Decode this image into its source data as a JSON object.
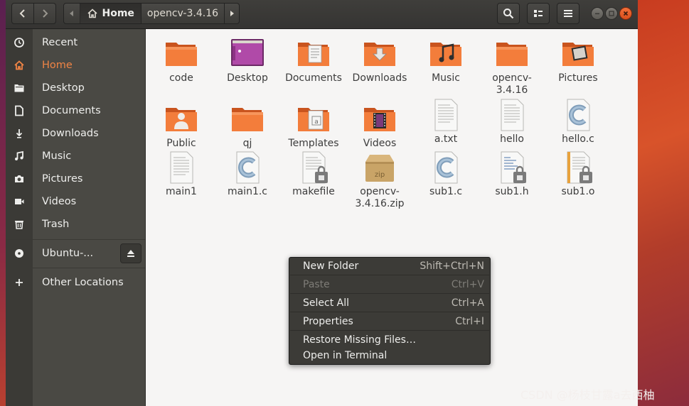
{
  "header": {
    "back_icon": "chevron-left-icon",
    "forward_icon": "chevron-right-icon",
    "path": [
      {
        "label": "Home",
        "icon": "home-icon"
      },
      {
        "label": "opencv-3.4.16"
      }
    ],
    "actions": [
      "search-icon",
      "view-toggle-icon",
      "menu-icon"
    ],
    "window_controls": [
      "minimize-icon",
      "maximize-icon",
      "close-icon"
    ]
  },
  "sidebar": {
    "items": [
      {
        "label": "Recent",
        "icon": "clock-icon"
      },
      {
        "label": "Home",
        "icon": "home-icon",
        "active": true
      },
      {
        "label": "Desktop",
        "icon": "folder-icon"
      },
      {
        "label": "Documents",
        "icon": "document-icon"
      },
      {
        "label": "Downloads",
        "icon": "download-icon"
      },
      {
        "label": "Music",
        "icon": "music-icon"
      },
      {
        "label": "Pictures",
        "icon": "camera-icon"
      },
      {
        "label": "Videos",
        "icon": "video-icon"
      },
      {
        "label": "Trash",
        "icon": "trash-icon"
      }
    ],
    "device": {
      "label": "Ubuntu-...",
      "icon": "disc-icon",
      "eject_icon": "eject-icon"
    },
    "other": {
      "label": "Other Locations",
      "icon": "plus-icon"
    }
  },
  "files": [
    {
      "name": "code",
      "type": "folder"
    },
    {
      "name": "Desktop",
      "type": "folder-desktop"
    },
    {
      "name": "Documents",
      "type": "folder-documents"
    },
    {
      "name": "Downloads",
      "type": "folder-downloads"
    },
    {
      "name": "Music",
      "type": "folder-music"
    },
    {
      "name": "opencv-\n3.4.16",
      "type": "folder"
    },
    {
      "name": "Pictures",
      "type": "folder-pictures"
    },
    {
      "name": "Public",
      "type": "folder-public"
    },
    {
      "name": "qj",
      "type": "folder"
    },
    {
      "name": "Templates",
      "type": "folder-templates"
    },
    {
      "name": "Videos",
      "type": "folder-videos"
    },
    {
      "name": "a.txt",
      "type": "text"
    },
    {
      "name": "hello",
      "type": "text"
    },
    {
      "name": "hello.c",
      "type": "c-source"
    },
    {
      "name": "main1",
      "type": "text"
    },
    {
      "name": "main1.c",
      "type": "c-source"
    },
    {
      "name": "makefile",
      "type": "text-locked"
    },
    {
      "name": "opencv-\n3.4.16.zip",
      "type": "zip"
    },
    {
      "name": "sub1.c",
      "type": "c-source"
    },
    {
      "name": "sub1.h",
      "type": "header-locked"
    },
    {
      "name": "sub1.o",
      "type": "object-locked"
    }
  ],
  "context_menu": {
    "items": [
      {
        "label": "New Folder",
        "shortcut": "Shift+Ctrl+N",
        "enabled": true
      },
      {
        "label": "Paste",
        "shortcut": "Ctrl+V",
        "enabled": false
      },
      {
        "label": "Select All",
        "shortcut": "Ctrl+A",
        "enabled": true
      },
      {
        "label": "Properties",
        "shortcut": "Ctrl+I",
        "enabled": true
      },
      {
        "label": "Restore Missing Files…",
        "shortcut": "",
        "enabled": true
      },
      {
        "label": "Open in Terminal",
        "shortcut": "",
        "enabled": true
      }
    ]
  },
  "watermark": "CSDN @杨枝甘露a去西柚",
  "colors": {
    "accent": "#e95420",
    "folder": "#f37d3b",
    "menu_bg": "#3c3b37",
    "sidebar_bg": "#4a4944"
  }
}
